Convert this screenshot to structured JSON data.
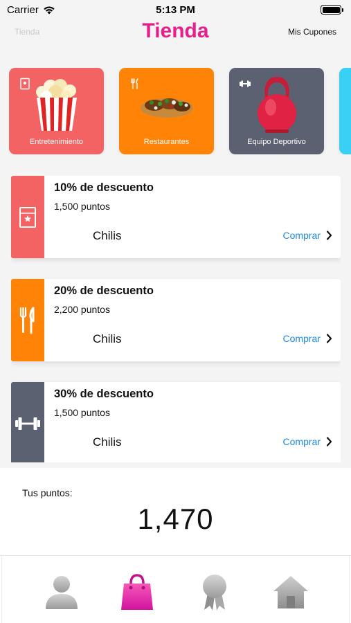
{
  "status_bar": {
    "carrier": "Carrier",
    "time": "5:13 PM"
  },
  "header": {
    "back_label": "Tienda",
    "title": "Tienda",
    "coupons_label": "Mis Cupones"
  },
  "categories": [
    {
      "label": "Entretenimiento",
      "color": "#f46363",
      "icon": "ticket-icon",
      "art": "popcorn"
    },
    {
      "label": "Restaurantes",
      "color": "#ff8306",
      "icon": "fork-knife-icon",
      "art": "tacos"
    },
    {
      "label": "Equipo Deportivo",
      "color": "#5b6170",
      "icon": "dumbbell-icon",
      "art": "kettlebell"
    },
    {
      "label": "",
      "color": "#3ad0f5",
      "icon": "",
      "art": ""
    }
  ],
  "offers": [
    {
      "title": "10% de descuento",
      "points": "1,500 puntos",
      "merchant": "Chilis",
      "buy_label": "Comprar",
      "color": "#f46363",
      "icon": "ticket-icon"
    },
    {
      "title": "20% de descuento",
      "points": "2,200 puntos",
      "merchant": "Chilis",
      "buy_label": "Comprar",
      "color": "#ff8306",
      "icon": "fork-knife-icon"
    },
    {
      "title": "30% de descuento",
      "points": "1,500 puntos",
      "merchant": "Chilis",
      "buy_label": "Comprar",
      "color": "#5b6170",
      "icon": "dumbbell-icon"
    }
  ],
  "points": {
    "label": "Tus puntos:",
    "value": "1,470"
  },
  "tab_bar": {
    "tabs": [
      {
        "name": "profile-icon",
        "active": false
      },
      {
        "name": "shopping-bag-icon",
        "active": true
      },
      {
        "name": "award-icon",
        "active": false
      },
      {
        "name": "home-icon",
        "active": false
      }
    ],
    "active_color": "#e81e8c"
  }
}
